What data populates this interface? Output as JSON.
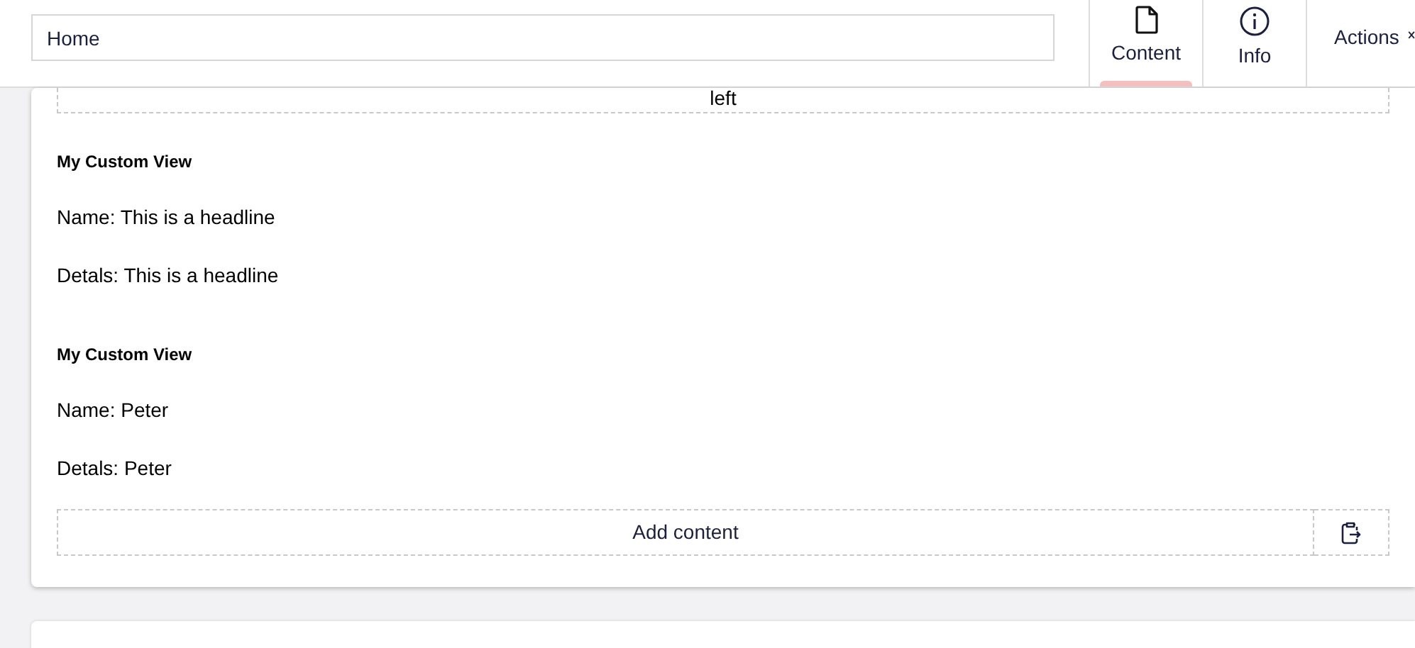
{
  "header": {
    "search": {
      "value": "Home"
    },
    "tabs": [
      {
        "label": "Content",
        "kind": "document",
        "selected": true
      },
      {
        "label": "Info",
        "kind": "info",
        "selected": false
      }
    ],
    "actions": {
      "label": "Actions"
    }
  },
  "card": {
    "top_slot": {
      "label": "left"
    },
    "views": [
      {
        "title": "My Custom View",
        "lines": [
          "Name: This is a headline",
          "Detals: This is a headline"
        ]
      },
      {
        "title": "My Custom View",
        "lines": [
          "Name: Peter",
          "Detals: Peter"
        ]
      }
    ],
    "add_button": {
      "label": "Add content"
    }
  }
}
